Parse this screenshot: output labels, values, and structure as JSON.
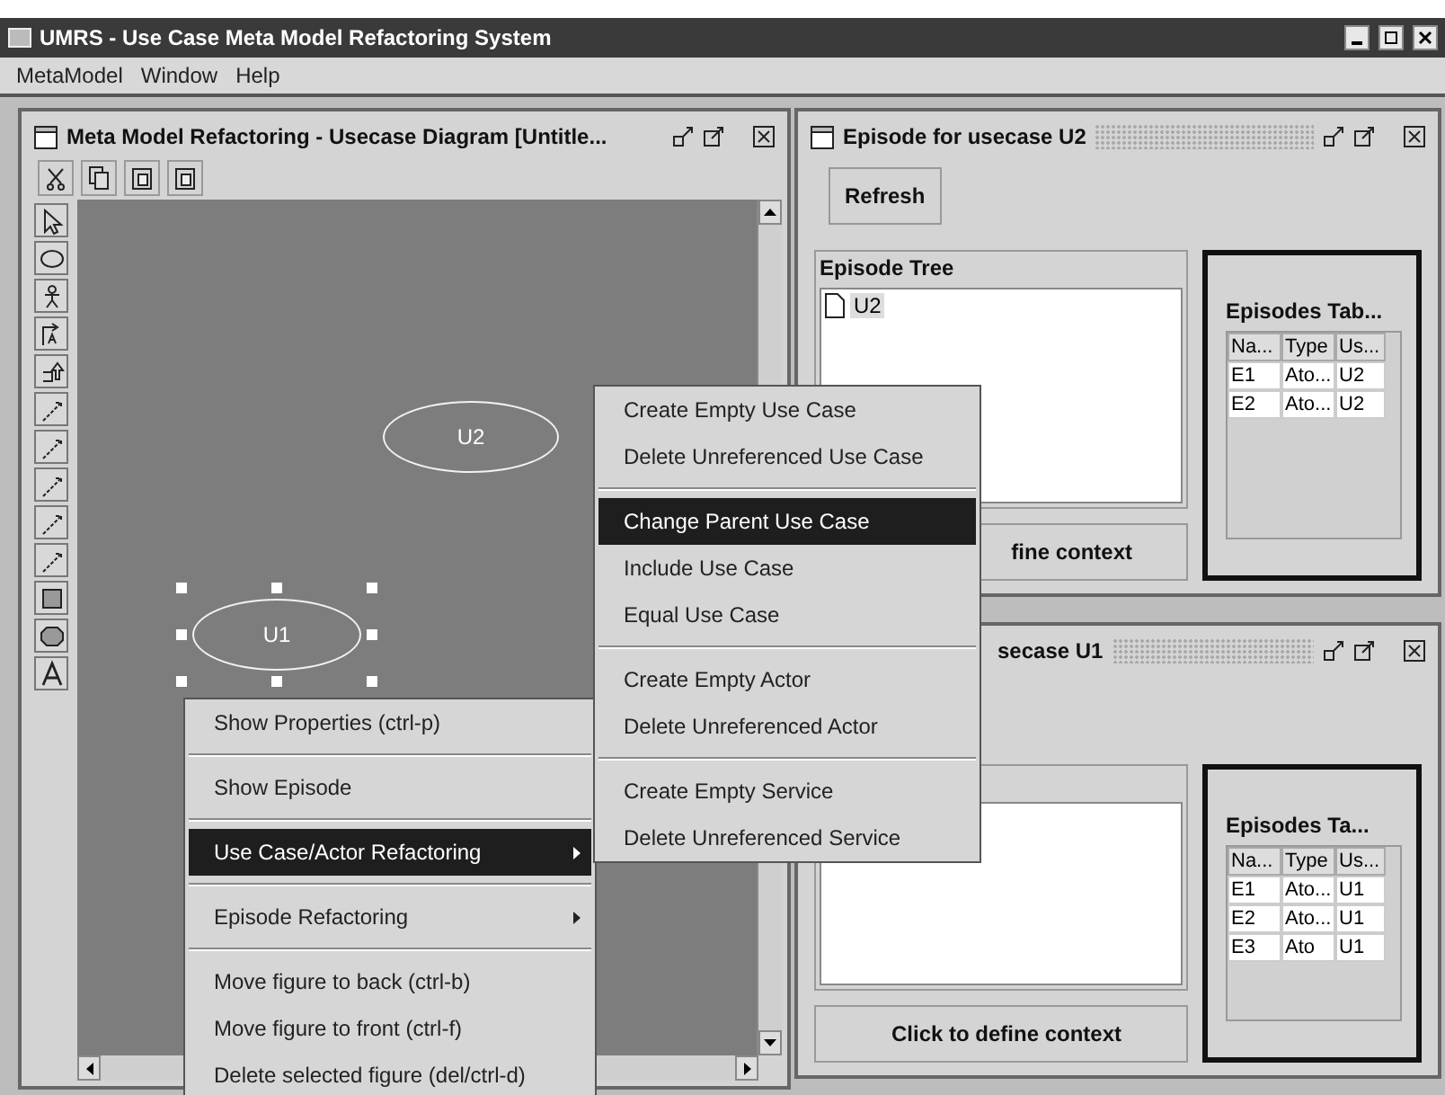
{
  "app": {
    "title": "UMRS - Use Case Meta Model Refactoring System",
    "menu": [
      "MetaModel",
      "Window",
      "Help"
    ]
  },
  "diagram_window": {
    "title": "Meta Model Refactoring - Usecase Diagram [Untitle...",
    "shapes": [
      {
        "label": "U2",
        "selected": false
      },
      {
        "label": "U1",
        "selected": true
      }
    ]
  },
  "episode_windows": [
    {
      "title": "Episode for usecase U2",
      "refresh": "Refresh",
      "tree_title": "Episode Tree",
      "tree_items": [
        "U2"
      ],
      "context_button": "fine context",
      "table_title": "Episodes Tab...",
      "columns": [
        "Na...",
        "Type",
        "Us..."
      ],
      "rows": [
        [
          "E1",
          "Ato...",
          "U2"
        ],
        [
          "E2",
          "Ato...",
          "U2"
        ]
      ]
    },
    {
      "title": "secase U1",
      "context_button": "Click to define context",
      "table_title": "Episodes Ta...",
      "columns": [
        "Na...",
        "Type",
        "Us..."
      ],
      "rows": [
        [
          "E1",
          "Ato...",
          "U1"
        ],
        [
          "E2",
          "Ato...",
          "U1"
        ],
        [
          "E3",
          "Ato",
          "U1"
        ]
      ]
    }
  ],
  "context_menu": {
    "items": [
      {
        "kind": "item",
        "label": "Show Properties (ctrl-p)",
        "selected": false,
        "submenu": false
      },
      {
        "kind": "separator"
      },
      {
        "kind": "item",
        "label": "Show Episode",
        "selected": false,
        "submenu": false
      },
      {
        "kind": "separator"
      },
      {
        "kind": "item",
        "label": "Use Case/Actor Refactoring",
        "selected": true,
        "submenu": true
      },
      {
        "kind": "separator"
      },
      {
        "kind": "item",
        "label": "Episode Refactoring",
        "selected": false,
        "submenu": true
      },
      {
        "kind": "separator"
      },
      {
        "kind": "item",
        "label": "Move figure to back (ctrl-b)",
        "selected": false,
        "submenu": false
      },
      {
        "kind": "item",
        "label": "Move figure to front (ctrl-f)",
        "selected": false,
        "submenu": false
      },
      {
        "kind": "item",
        "label": "Delete selected figure (del/ctrl-d)",
        "selected": false,
        "submenu": false
      }
    ]
  },
  "submenu": {
    "items": [
      {
        "kind": "item",
        "label": "Create Empty Use Case",
        "selected": false
      },
      {
        "kind": "item",
        "label": "Delete Unreferenced Use Case",
        "selected": false
      },
      {
        "kind": "separator"
      },
      {
        "kind": "item",
        "label": "Change Parent Use Case",
        "selected": true
      },
      {
        "kind": "item",
        "label": "Include Use Case",
        "selected": false
      },
      {
        "kind": "item",
        "label": "Equal Use Case",
        "selected": false
      },
      {
        "kind": "separator"
      },
      {
        "kind": "item",
        "label": "Create Empty Actor",
        "selected": false
      },
      {
        "kind": "item",
        "label": "Delete Unreferenced Actor",
        "selected": false
      },
      {
        "kind": "separator"
      },
      {
        "kind": "item",
        "label": "Create Empty Service",
        "selected": false
      },
      {
        "kind": "item",
        "label": "Delete Unreferenced Service",
        "selected": false
      }
    ]
  }
}
